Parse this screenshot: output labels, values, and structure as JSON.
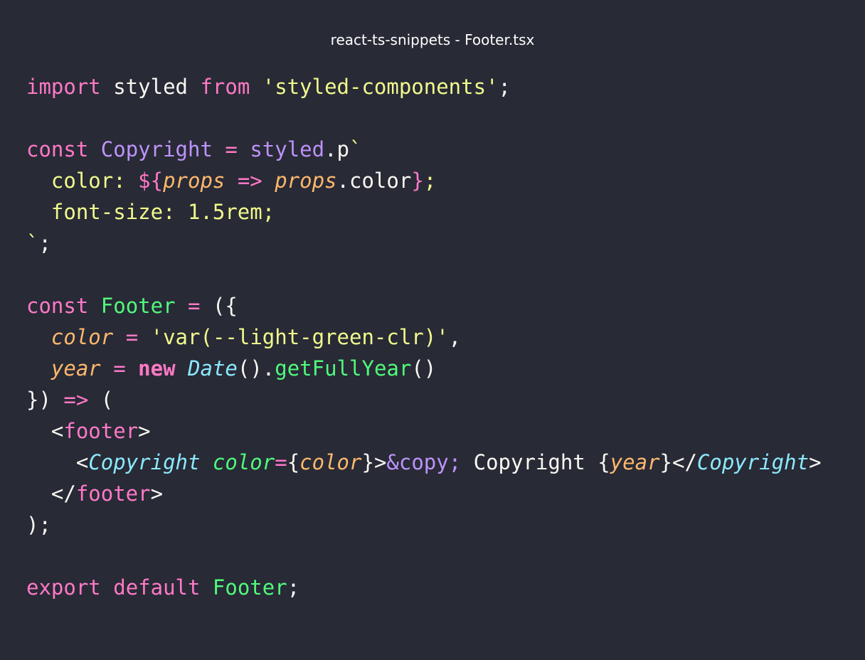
{
  "window": {
    "title": "react-ts-snippets - Footer.tsx"
  },
  "colors": {
    "background": "#282a36",
    "foreground": "#f8f8f2",
    "keyword": "#ff79c6",
    "string": "#f1fa8c",
    "class": "#bd93f9",
    "function": "#50fa7b",
    "parameter": "#ffb86c",
    "type": "#8be9fd"
  },
  "code_lines": [
    [
      {
        "t": "import",
        "c": "keyword"
      },
      {
        "t": " styled ",
        "c": "plain"
      },
      {
        "t": "from",
        "c": "keyword"
      },
      {
        "t": " ",
        "c": "plain"
      },
      {
        "t": "'styled-components'",
        "c": "string"
      },
      {
        "t": ";",
        "c": "plain"
      }
    ],
    [],
    [
      {
        "t": "const",
        "c": "keyword"
      },
      {
        "t": " ",
        "c": "plain"
      },
      {
        "t": "Copyright",
        "c": "class"
      },
      {
        "t": " ",
        "c": "plain"
      },
      {
        "t": "=",
        "c": "op"
      },
      {
        "t": " ",
        "c": "plain"
      },
      {
        "t": "styled",
        "c": "class"
      },
      {
        "t": ".p",
        "c": "plain"
      },
      {
        "t": "`",
        "c": "string"
      }
    ],
    [
      {
        "t": "  color: ",
        "c": "prop"
      },
      {
        "t": "${",
        "c": "keyword"
      },
      {
        "t": "props",
        "c": "param"
      },
      {
        "t": " ",
        "c": "plain"
      },
      {
        "t": "=>",
        "c": "op"
      },
      {
        "t": " ",
        "c": "plain"
      },
      {
        "t": "props",
        "c": "param"
      },
      {
        "t": ".color",
        "c": "plain"
      },
      {
        "t": "}",
        "c": "keyword"
      },
      {
        "t": ";",
        "c": "prop"
      }
    ],
    [
      {
        "t": "  font-size: 1.5rem;",
        "c": "prop"
      }
    ],
    [
      {
        "t": "`",
        "c": "string"
      },
      {
        "t": ";",
        "c": "plain"
      }
    ],
    [],
    [
      {
        "t": "const",
        "c": "keyword"
      },
      {
        "t": " ",
        "c": "plain"
      },
      {
        "t": "Footer",
        "c": "func"
      },
      {
        "t": " ",
        "c": "plain"
      },
      {
        "t": "=",
        "c": "op"
      },
      {
        "t": " ({",
        "c": "plain"
      }
    ],
    [
      {
        "t": "  ",
        "c": "plain"
      },
      {
        "t": "color",
        "c": "param"
      },
      {
        "t": " ",
        "c": "plain"
      },
      {
        "t": "=",
        "c": "op"
      },
      {
        "t": " ",
        "c": "plain"
      },
      {
        "t": "'var(--light-green-clr)'",
        "c": "string"
      },
      {
        "t": ",",
        "c": "plain"
      }
    ],
    [
      {
        "t": "  ",
        "c": "plain"
      },
      {
        "t": "year",
        "c": "param"
      },
      {
        "t": " ",
        "c": "plain"
      },
      {
        "t": "=",
        "c": "op"
      },
      {
        "t": " ",
        "c": "plain"
      },
      {
        "t": "new",
        "c": "keyword-bold"
      },
      {
        "t": " ",
        "c": "plain"
      },
      {
        "t": "Date",
        "c": "type"
      },
      {
        "t": "().",
        "c": "plain"
      },
      {
        "t": "getFullYear",
        "c": "func"
      },
      {
        "t": "()",
        "c": "plain"
      }
    ],
    [
      {
        "t": "}) ",
        "c": "plain"
      },
      {
        "t": "=>",
        "c": "op"
      },
      {
        "t": " (",
        "c": "plain"
      }
    ],
    [
      {
        "t": "  <",
        "c": "plain"
      },
      {
        "t": "footer",
        "c": "keyword"
      },
      {
        "t": ">",
        "c": "plain"
      }
    ],
    [
      {
        "t": "    <",
        "c": "plain"
      },
      {
        "t": "Copyright",
        "c": "type"
      },
      {
        "t": " ",
        "c": "plain"
      },
      {
        "t": "color",
        "c": "attr"
      },
      {
        "t": "=",
        "c": "op"
      },
      {
        "t": "{",
        "c": "plain"
      },
      {
        "t": "color",
        "c": "param"
      },
      {
        "t": "}>",
        "c": "plain"
      },
      {
        "t": "&copy;",
        "c": "class"
      },
      {
        "t": " Copyright {",
        "c": "plain"
      },
      {
        "t": "year",
        "c": "param"
      },
      {
        "t": "}</",
        "c": "plain"
      },
      {
        "t": "Copyright",
        "c": "type"
      },
      {
        "t": ">",
        "c": "plain"
      }
    ],
    [
      {
        "t": "  </",
        "c": "plain"
      },
      {
        "t": "footer",
        "c": "keyword"
      },
      {
        "t": ">",
        "c": "plain"
      }
    ],
    [
      {
        "t": ");",
        "c": "plain"
      }
    ],
    [],
    [
      {
        "t": "export",
        "c": "keyword"
      },
      {
        "t": " ",
        "c": "plain"
      },
      {
        "t": "default",
        "c": "keyword"
      },
      {
        "t": " ",
        "c": "plain"
      },
      {
        "t": "Footer",
        "c": "func"
      },
      {
        "t": ";",
        "c": "plain"
      }
    ]
  ]
}
